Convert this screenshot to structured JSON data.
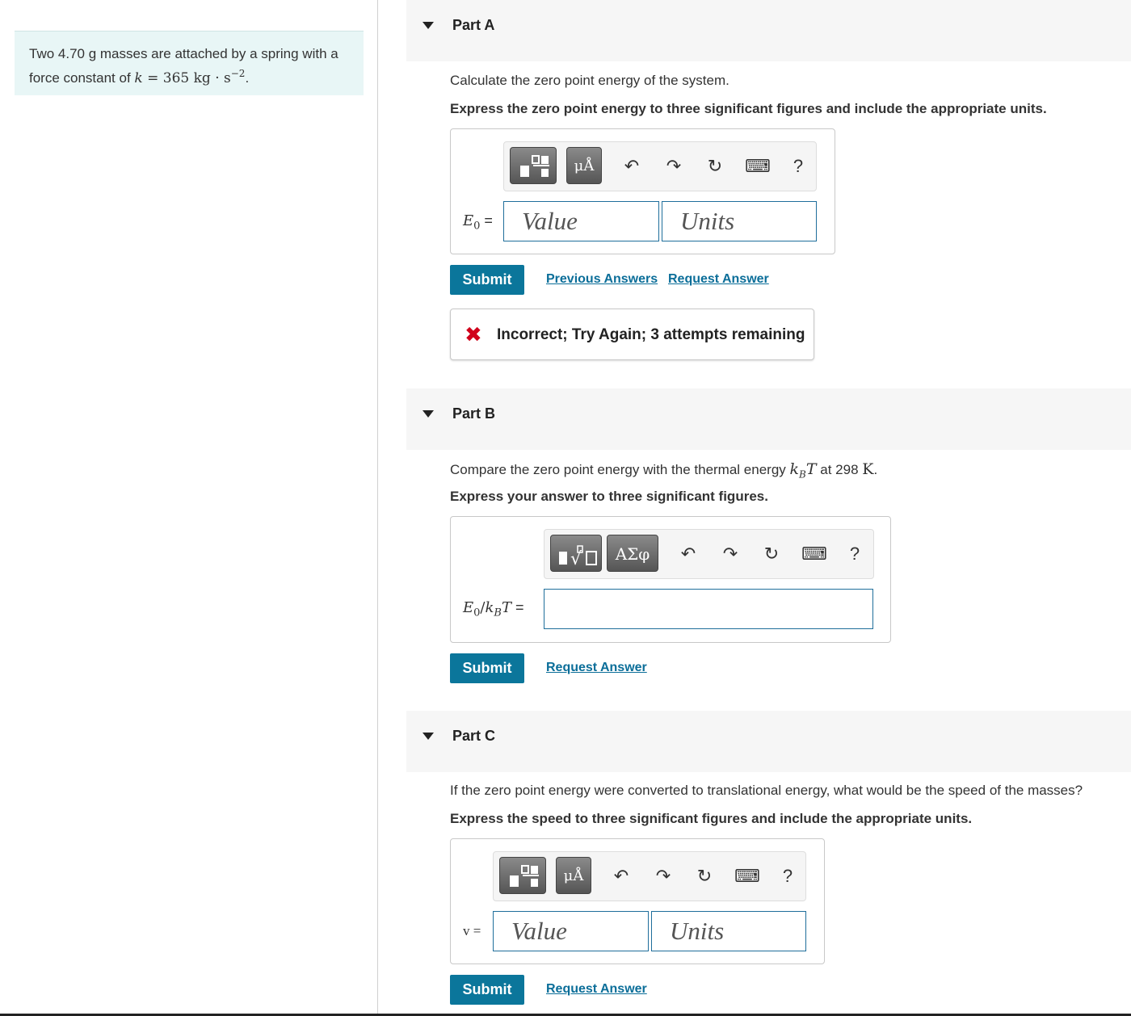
{
  "problem": {
    "text_before": "Two 4.70 g masses are attached by a spring with a force constant of ",
    "k_symbol": "k",
    "equals": " = 365 kg · s",
    "exponent": "−2",
    "period": "."
  },
  "part_a": {
    "title": "Part A",
    "question": "Calculate the zero point energy of the system.",
    "instruction": "Express the zero point energy to three significant figures and include the appropriate units.",
    "toolbar": {
      "btn1_icon": "templates-icon",
      "btn2_label": "μÅ",
      "help": "?"
    },
    "label_symbol": "E",
    "label_sub": "0",
    "label_eq": " =",
    "value_placeholder": "Value",
    "units_placeholder": "Units",
    "submit": "Submit",
    "previous_answers": "Previous Answers",
    "request_answer": "Request Answer",
    "feedback_icon": "✖",
    "feedback": "Incorrect; Try Again; 3 attempts remaining"
  },
  "part_b": {
    "title": "Part B",
    "question_before": "Compare the zero point energy with the thermal energy ",
    "question_math": "k",
    "question_math_sub": "B",
    "question_math_T": "T",
    "question_after": " at 298 ",
    "question_unit": "K",
    "question_end": ".",
    "instruction": "Express your answer to three significant figures.",
    "toolbar": {
      "btn1_label": "√▫",
      "btn2_label": "ΑΣφ",
      "help": "?"
    },
    "label_E": "E",
    "label_sub0": "0",
    "label_slash": "/",
    "label_k": "k",
    "label_subB": "B",
    "label_T": "T",
    "label_eq": " =",
    "submit": "Submit",
    "request_answer": "Request Answer"
  },
  "part_c": {
    "title": "Part C",
    "question": "If the zero point energy were converted to translational energy, what would be the speed of the masses?",
    "instruction": "Express the speed to three significant figures and include the appropriate units.",
    "toolbar": {
      "btn2_label": "μÅ",
      "help": "?"
    },
    "label": "v =",
    "value_placeholder": "Value",
    "units_placeholder": "Units",
    "submit": "Submit",
    "request_answer": "Request Answer"
  },
  "icons": {
    "undo": "↶",
    "redo": "↷",
    "reset": "↻",
    "keyboard": "⌨"
  },
  "colors": {
    "accent": "#0b769b",
    "link": "#0b6e99",
    "error": "#d0021b",
    "problem_bg": "#e8f6f6"
  }
}
